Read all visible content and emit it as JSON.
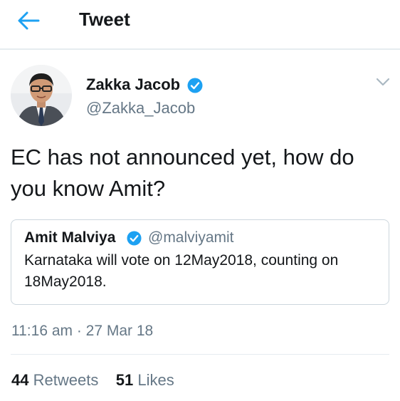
{
  "header": {
    "title": "Tweet",
    "back_icon": "arrow-left-icon",
    "accent": "#1da1f2"
  },
  "tweet": {
    "author_name": "Zakka Jacob",
    "author_handle": "@Zakka_Jacob",
    "verified_icon": "verified-badge-icon",
    "menu_icon": "chevron-down-icon",
    "text": "EC has not announced yet, how do you know Amit?",
    "timestamp": "11:16 am · 27 Mar 18"
  },
  "quoted_tweet": {
    "author_name": "Amit Malviya",
    "author_handle": "@malviyamit",
    "text": "Karnataka will vote on 12May2018, counting on 18May2018."
  },
  "stats": {
    "retweets_count": "44",
    "retweets_label": "Retweets",
    "likes_count": "51",
    "likes_label": "Likes"
  }
}
